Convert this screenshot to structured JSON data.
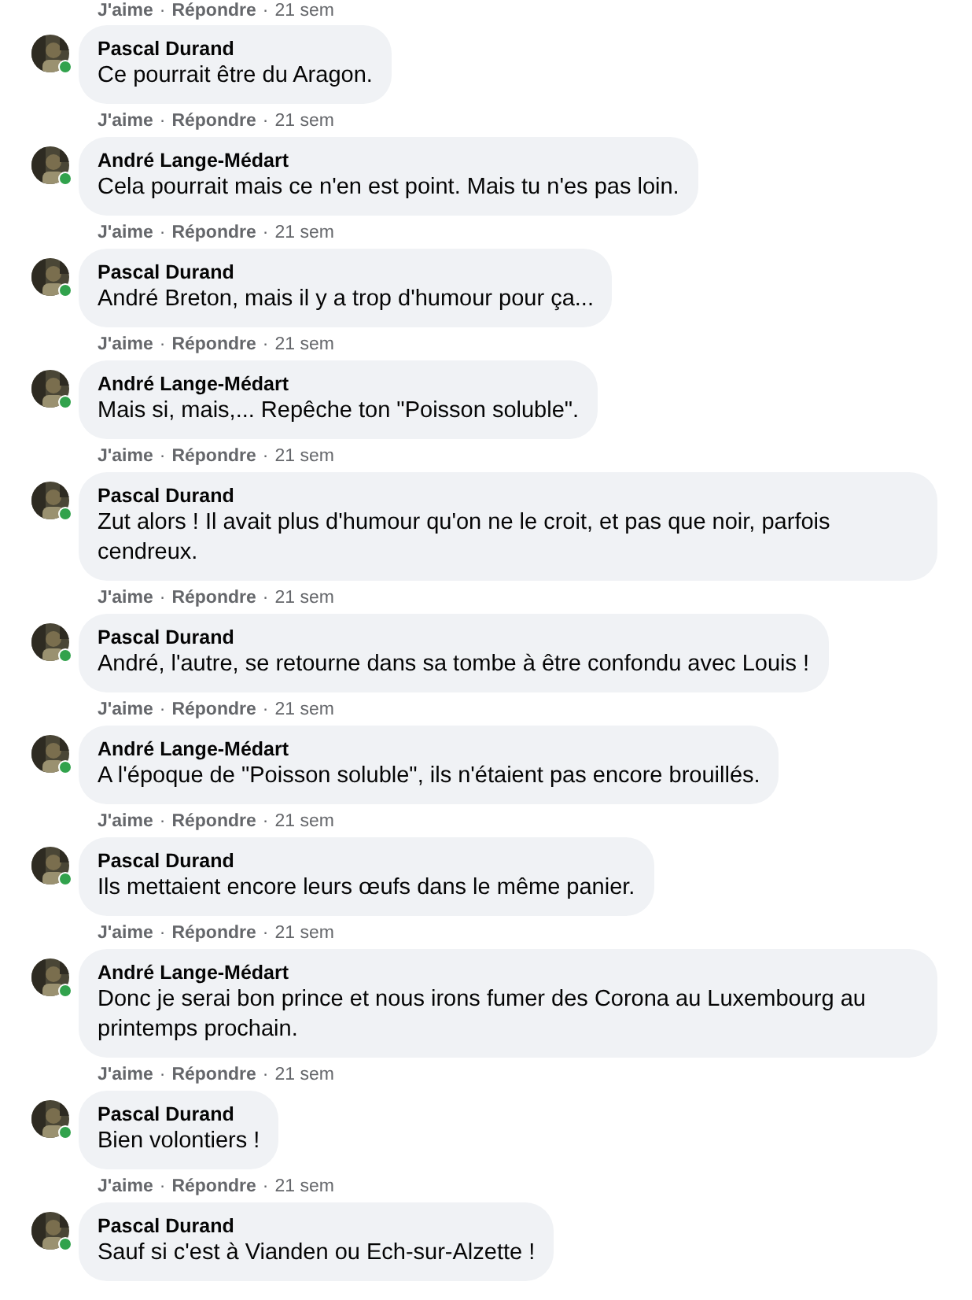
{
  "top_actions": {
    "like": "J'aime",
    "sep1": "·",
    "reply": "Répondre",
    "sep2": "·",
    "time": "21 sem"
  },
  "comments": [
    {
      "author": "Pascal Durand",
      "online": true,
      "text": "Ce pourrait être du Aragon.",
      "actions": {
        "like": "J'aime",
        "sep1": "·",
        "reply": "Répondre",
        "sep2": "·",
        "time": "21 sem"
      }
    },
    {
      "author": "André Lange-Médart",
      "online": true,
      "text": "Cela pourrait mais ce n'en est point. Mais tu n'es pas loin.",
      "actions": {
        "like": "J'aime",
        "sep1": "·",
        "reply": "Répondre",
        "sep2": "·",
        "time": "21 sem"
      }
    },
    {
      "author": "Pascal Durand",
      "online": true,
      "text": "André Breton, mais il y a trop d'humour pour ça...",
      "actions": {
        "like": "J'aime",
        "sep1": "·",
        "reply": "Répondre",
        "sep2": "·",
        "time": "21 sem"
      }
    },
    {
      "author": "André Lange-Médart",
      "online": true,
      "text": "Mais si, mais,... Repêche ton \"Poisson soluble\".",
      "actions": {
        "like": "J'aime",
        "sep1": "·",
        "reply": "Répondre",
        "sep2": "·",
        "time": "21 sem"
      }
    },
    {
      "author": "Pascal Durand",
      "online": true,
      "text": "Zut alors ! Il avait plus d'humour qu'on ne le croit, et pas que noir, parfois cendreux.",
      "actions": {
        "like": "J'aime",
        "sep1": "·",
        "reply": "Répondre",
        "sep2": "·",
        "time": "21 sem"
      }
    },
    {
      "author": "Pascal Durand",
      "online": true,
      "text": "André, l'autre, se retourne dans sa tombe à être confondu avec Louis !",
      "actions": {
        "like": "J'aime",
        "sep1": "·",
        "reply": "Répondre",
        "sep2": "·",
        "time": "21 sem"
      }
    },
    {
      "author": "André Lange-Médart",
      "online": true,
      "text": "A l'époque de \"Poisson soluble\", ils n'étaient pas encore brouillés.",
      "actions": {
        "like": "J'aime",
        "sep1": "·",
        "reply": "Répondre",
        "sep2": "·",
        "time": "21 sem"
      }
    },
    {
      "author": "Pascal Durand",
      "online": true,
      "text": "Ils mettaient encore leurs œufs dans le même panier.",
      "actions": {
        "like": "J'aime",
        "sep1": "·",
        "reply": "Répondre",
        "sep2": "·",
        "time": "21 sem"
      }
    },
    {
      "author": "André Lange-Médart",
      "online": true,
      "text": "Donc je serai bon prince et nous irons fumer des Corona au Luxembourg au printemps prochain.",
      "actions": {
        "like": "J'aime",
        "sep1": "·",
        "reply": "Répondre",
        "sep2": "·",
        "time": "21 sem"
      }
    },
    {
      "author": "Pascal Durand",
      "online": true,
      "text": "Bien volontiers !",
      "actions": {
        "like": "J'aime",
        "sep1": "·",
        "reply": "Répondre",
        "sep2": "·",
        "time": "21 sem"
      }
    },
    {
      "author": "Pascal Durand",
      "online": true,
      "text": "Sauf si c'est à Vianden ou Ech-sur-Alzette !"
    }
  ]
}
